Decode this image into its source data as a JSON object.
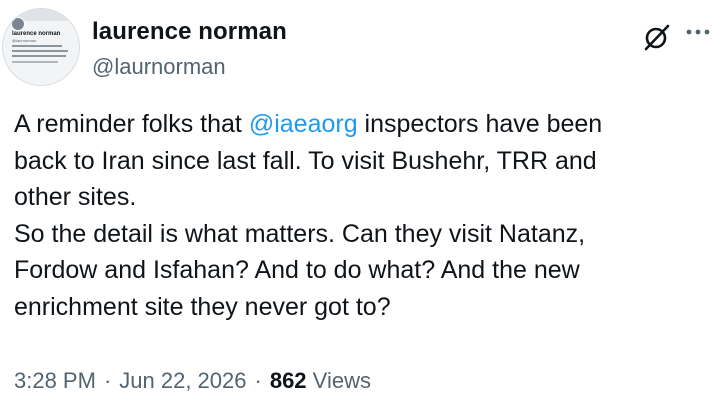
{
  "author": {
    "display_name": "laurence norman",
    "handle": "@laurnorman",
    "avatar_mini": {
      "name": "laurence norman",
      "handle": "@laurnorman"
    }
  },
  "tweet": {
    "lines": [
      {
        "before": "A reminder folks that ",
        "mention": "@iaeaorg",
        "after": " inspectors have been"
      },
      {
        "text": "back to Iran since last fall. To visit Bushehr, TRR and"
      },
      {
        "text": "other sites."
      },
      {
        "text": "So the detail is what matters. Can they visit Natanz,"
      },
      {
        "text": "Fordow and Isfahan? And to do what? And the new"
      },
      {
        "text": "enrichment site they never got to?"
      }
    ]
  },
  "meta": {
    "time": "3:28 PM",
    "separator": "·",
    "date": "Jun 22, 2026",
    "views_count": "862",
    "views_label": "Views"
  },
  "icons": {
    "grok": "grok-icon",
    "more": "more-icon"
  },
  "colors": {
    "text": "#0f1419",
    "secondary": "#536471",
    "mention": "#1d9bf0",
    "background": "#ffffff"
  }
}
